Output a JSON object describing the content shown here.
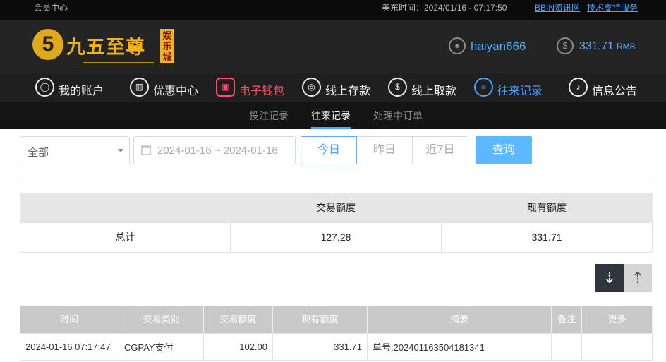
{
  "topbar": {
    "member_center": "会员中心",
    "time_label": "美东时间：2024/01/16 - 07:17:50",
    "link_bbin": "BBIN资讯网",
    "link_support": "技术支持服务"
  },
  "brand": {
    "mark": "5",
    "name": "九五至尊",
    "badge": "娱乐城"
  },
  "account": {
    "username": "haiyan666",
    "balance": "331.71",
    "currency": "RMB"
  },
  "nav": {
    "items": [
      {
        "label": "我的账户",
        "icon": "user-icon"
      },
      {
        "label": "优惠中心",
        "icon": "gift-icon"
      },
      {
        "label": "电子钱包",
        "icon": "wallet-icon"
      },
      {
        "label": "线上存款",
        "icon": "deposit-icon"
      },
      {
        "label": "线上取款",
        "icon": "withdraw-icon"
      },
      {
        "label": "往来记录",
        "icon": "records-icon"
      },
      {
        "label": "信息公告",
        "icon": "bell-icon"
      }
    ]
  },
  "subnav": {
    "items": [
      "投注记录",
      "往来记录",
      "处理中订单"
    ],
    "active": "往来记录"
  },
  "filter": {
    "type_value": "全部",
    "date_range": "2024-01-16 ~ 2024-01-16",
    "today": "今日",
    "yesterday": "昨日",
    "last7": "近7日",
    "search": "查询"
  },
  "summary": {
    "headers": [
      "",
      "交易额度",
      "现有额度"
    ],
    "row": [
      "总计",
      "127.28",
      "331.71"
    ]
  },
  "records": {
    "headers": [
      "时间",
      "交易类别",
      "交易额度",
      "现有额度",
      "摘要",
      "备注",
      "更多"
    ],
    "rows": [
      [
        "2024-01-16 07:17:47",
        "CGPAY支付",
        "102.00",
        "331.71",
        "单号:202401163504181341",
        "",
        ""
      ]
    ]
  },
  "colors": {
    "accent_blue": "#4aa3ff",
    "wallet_red": "#ff4d6a",
    "brand_gold": "#f2b21a"
  }
}
